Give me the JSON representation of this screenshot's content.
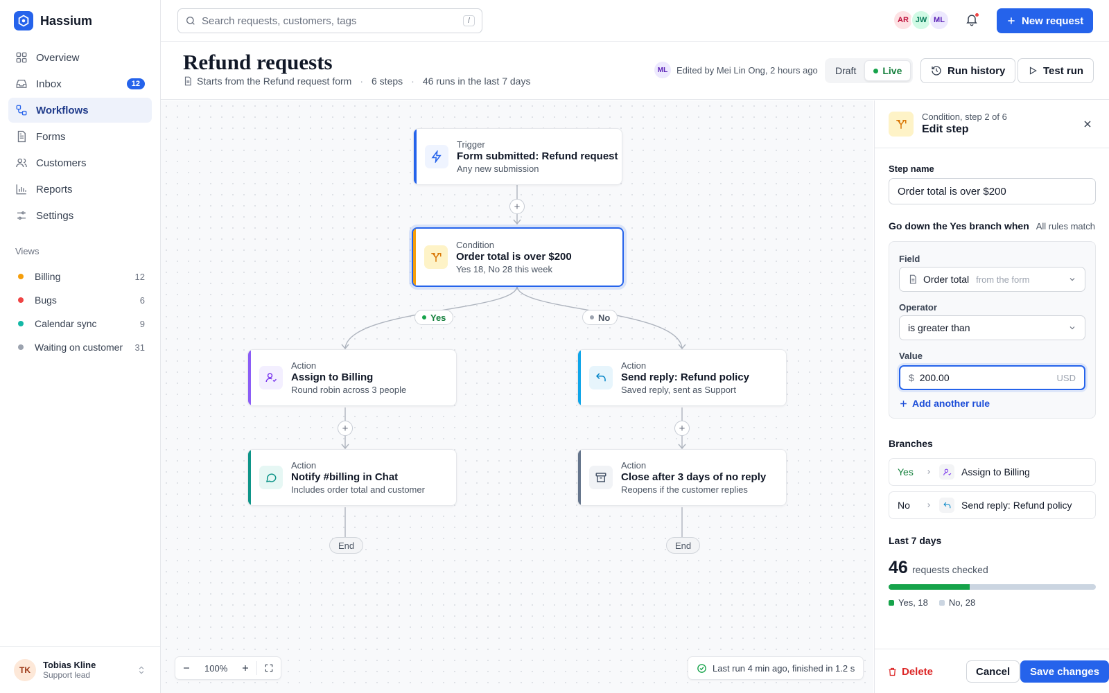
{
  "app": {
    "name": "Hassium"
  },
  "nav": [
    {
      "label": "Overview",
      "icon": "grid-icon"
    },
    {
      "label": "Inbox",
      "icon": "inbox-icon",
      "badge": "12"
    },
    {
      "label": "Workflows",
      "icon": "workflow-icon",
      "active": true
    },
    {
      "label": "Forms",
      "icon": "form-icon"
    },
    {
      "label": "Customers",
      "icon": "users-icon"
    },
    {
      "label": "Reports",
      "icon": "bar-chart-icon"
    },
    {
      "label": "Settings",
      "icon": "sliders-icon"
    }
  ],
  "views": {
    "title": "Views",
    "items": [
      {
        "label": "Billing",
        "count": "12",
        "color": "#f59e0b"
      },
      {
        "label": "Bugs",
        "count": "6",
        "color": "#ef4444"
      },
      {
        "label": "Calendar sync",
        "count": "9",
        "color": "#14b8a6"
      },
      {
        "label": "Waiting on customer",
        "count": "31",
        "color": "#9ca3af"
      }
    ]
  },
  "user": {
    "initials": "TK",
    "name": "Tobias Kline",
    "role": "Support lead"
  },
  "search": {
    "placeholder": "Search requests, customers, tags",
    "shortcut": "/"
  },
  "collaborators": [
    {
      "initials": "AR",
      "bg": "#fde2e4",
      "fg": "#be123c"
    },
    {
      "initials": "JW",
      "bg": "#d1fae5",
      "fg": "#047857"
    },
    {
      "initials": "ML",
      "bg": "#ede9fe",
      "fg": "#5b21b6"
    }
  ],
  "header": {
    "new_request": "New request"
  },
  "page": {
    "title": "Refund requests",
    "meta_source": "Starts from the Refund request form",
    "meta_steps": "6 steps",
    "meta_runs": "46 runs in the last 7 days",
    "editor_initials": "ML",
    "edited": "Edited by Mei Lin Ong, 2 hours ago",
    "draft": "Draft",
    "live": "Live",
    "run_history": "Run history",
    "test_run": "Test run"
  },
  "workflow": {
    "trigger": {
      "kind": "Trigger",
      "title": "Form submitted: Refund request",
      "sub": "Any new submission"
    },
    "condition": {
      "kind": "Condition",
      "title": "Order total is over $200",
      "sub": "Yes 18, No 28 this week"
    },
    "yes_label": "Yes",
    "no_label": "No",
    "yes_1": {
      "kind": "Action",
      "title": "Assign to Billing",
      "sub": "Round robin across 3 people"
    },
    "yes_2": {
      "kind": "Action",
      "title": "Notify #billing in Chat",
      "sub": "Includes order total and customer"
    },
    "no_1": {
      "kind": "Action",
      "title": "Send reply: Refund policy",
      "sub": "Saved reply, sent as Support"
    },
    "no_2": {
      "kind": "Action",
      "title": "Close after 3 days of no reply",
      "sub": "Reopens if the customer replies"
    },
    "end_label": "End"
  },
  "canvas": {
    "zoom": "100%",
    "last_run": "Last run 4 min ago, finished in 1.2 s"
  },
  "panel": {
    "subtitle": "Condition, step 2 of 6",
    "title": "Edit step",
    "step_name_label": "Step name",
    "step_name_value": "Order total is over $200",
    "rule_heading": "Go down the Yes branch when",
    "rule_mode": "All rules match",
    "field_label": "Field",
    "field_value": "Order total",
    "field_hint": "from the form",
    "operator_label": "Operator",
    "operator_value": "is greater than",
    "value_label": "Value",
    "value_prefix": "$",
    "value_value": "200.00",
    "value_suffix": "USD",
    "add_rule": "Add another rule",
    "branches_label": "Branches",
    "branch_yes_key": "Yes",
    "branch_yes_target": "Assign to Billing",
    "branch_no_key": "No",
    "branch_no_target": "Send reply: Refund policy",
    "stats_label": "Last 7 days",
    "stats_total": "46",
    "stats_total_label": "requests checked",
    "stats_yes_fraction": 0.391,
    "legend_yes": "Yes, 18",
    "legend_no": "No, 28",
    "delete": "Delete",
    "cancel": "Cancel",
    "save": "Save changes"
  }
}
